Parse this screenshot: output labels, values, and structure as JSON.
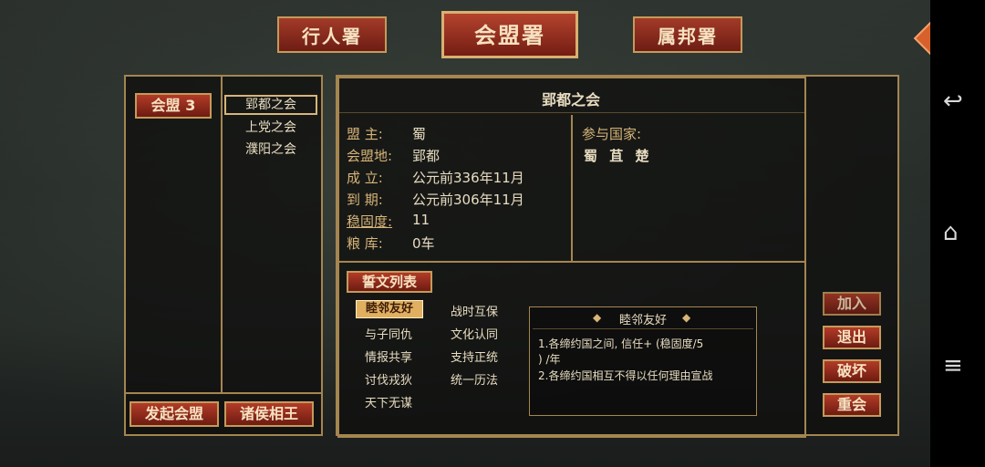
{
  "tabs": [
    {
      "label": "行人署"
    },
    {
      "label": "会盟署"
    },
    {
      "label": "属邦署"
    }
  ],
  "left": {
    "category_label": "会盟 3",
    "meetings": [
      "郢都之会",
      "上党之会",
      "濮阳之会"
    ],
    "btn_start": "发起会盟",
    "btn_kings": "诸侯相王"
  },
  "detail": {
    "title": "郢都之会",
    "rows": [
      {
        "label": "盟 主:",
        "value": "蜀"
      },
      {
        "label": "会盟地:",
        "value": "郢都"
      },
      {
        "label": "成 立:",
        "value": "公元前336年11月"
      },
      {
        "label": "到 期:",
        "value": "公元前306年11月"
      },
      {
        "label": "稳固度:",
        "value": "11"
      },
      {
        "label": "粮 库:",
        "value": "0车"
      }
    ],
    "states_label": "参与国家:",
    "states": "蜀 苴 楚"
  },
  "oaths": {
    "header": "誓文列表",
    "items": [
      "睦邻友好",
      "战时互保",
      "与子同仇",
      "文化认同",
      "情报共享",
      "支持正统",
      "讨伐戎狄",
      "统一历法",
      "天下无谋"
    ],
    "selected_title": "睦邻友好",
    "desc1": "1.各缔约国之间, 信任+ (稳固度/5",
    "desc1b": ") /年",
    "desc2": "2.各缔约国相互不得以任何理由宣战"
  },
  "actions": [
    "加入",
    "退出",
    "破坏",
    "重会"
  ],
  "colors": {
    "accent": "#a23a28",
    "border": "#a58550",
    "highlight": "#e0b060"
  }
}
